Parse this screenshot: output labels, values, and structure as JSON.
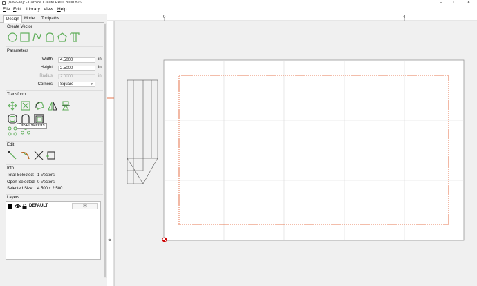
{
  "window": {
    "title": "[NewFile]* - Carbide Create PRO: Build 826",
    "buttons": [
      "–",
      "□",
      "✕"
    ]
  },
  "menu": [
    {
      "label": "File",
      "accel": "F",
      "rest": "ile"
    },
    {
      "label": "Edit",
      "accel": "E",
      "rest": "dit"
    },
    {
      "label": "Library",
      "accel": "",
      "rest": "Library"
    },
    {
      "label": "View",
      "accel": "",
      "rest": "View"
    },
    {
      "label": "Help",
      "accel": "H",
      "rest": "elp"
    }
  ],
  "tabs": [
    {
      "label": "Design",
      "active": true
    },
    {
      "label": "Model",
      "active": false
    },
    {
      "label": "Toolpaths",
      "active": false
    }
  ],
  "sections": {
    "create_vector": "Create Vector",
    "parameters": "Parameters",
    "transform": "Transform",
    "edit": "Edit",
    "info": "Info",
    "layers": "Layers"
  },
  "create_tools": [
    "circle-icon",
    "rectangle-icon",
    "curve-icon",
    "arch-icon",
    "polygon-icon",
    "text-icon"
  ],
  "transform_tools": [
    "move-icon",
    "scale-icon",
    "rotate-icon",
    "mirror-icon",
    "align-icon",
    "offset-icon",
    "boolean-icon",
    "offset-vectors-icon",
    "array-icon",
    "circular-array-icon"
  ],
  "edit_tools": [
    "node-edit-icon",
    "curve-edit-icon",
    "trim-icon",
    "join-icon"
  ],
  "parameters": {
    "width": {
      "label": "Width",
      "value": "4.5000",
      "unit": "in"
    },
    "height": {
      "label": "Height",
      "value": "2.5000",
      "unit": "in"
    },
    "radius": {
      "label": "Radius",
      "value": "2.0000",
      "unit": "in"
    },
    "corners": {
      "label": "Corners",
      "value": "Square"
    }
  },
  "tooltip": "Offset Vectors",
  "info": {
    "total_selected_label": "Total Selected:",
    "total_selected_value": "1 Vectors",
    "open_selected_label": "Open Selected:",
    "open_selected_value": "0 Vectors",
    "selected_size_label": "Selected Size:",
    "selected_size_value": "4.500 x 2.500"
  },
  "layer": {
    "name": "DEFAULT",
    "color": "#000000"
  },
  "ruler": {
    "top_labels": [
      "0",
      "4"
    ],
    "left_labels": [
      "0"
    ]
  },
  "colors": {
    "accent_green": "#5fae5a",
    "selection_orange": "#e0501e",
    "stock_border": "#888888"
  }
}
